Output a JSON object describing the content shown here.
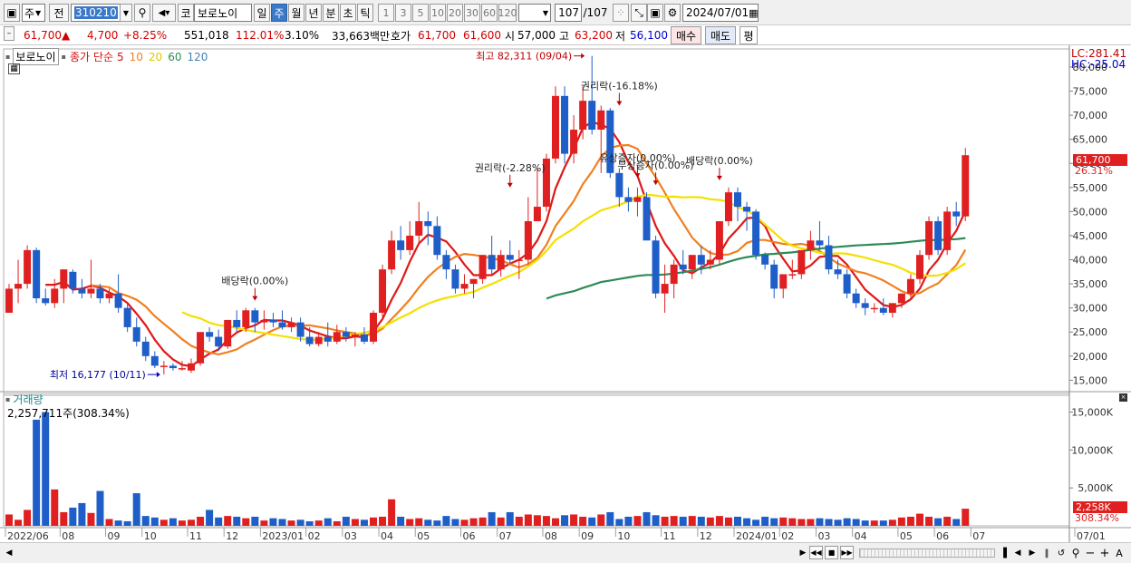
{
  "toolbar": {
    "market_type": "주",
    "prev_label": "전",
    "code": "310210",
    "stock_type": "코",
    "stock_name": "보로노이",
    "period_day": "일",
    "period_week": "주",
    "period_month": "월",
    "period_year": "년",
    "period_min": "분",
    "period_sec": "초",
    "period_tick": "틱",
    "intervals": [
      "1",
      "3",
      "5",
      "10",
      "20",
      "30",
      "60",
      "120"
    ],
    "count": "107",
    "count_total": "/107",
    "date": "2024/07/01"
  },
  "quote": {
    "price": "61,700",
    "change_arrow": "▲",
    "change": "4,700",
    "change_pct": "+8.25%",
    "volume": "551,018",
    "volume_ratio": "112.01%",
    "turnover": "3.10%",
    "amount": "33,663백만",
    "ask_label": "호가",
    "ask": "61,700",
    "bid": "61,600",
    "open_label": "시",
    "open": "57,000",
    "high_label": "고",
    "high": "63,200",
    "low_label": "저",
    "low": "56,100",
    "buy_label": "매수",
    "sell_label": "매도",
    "eval_label": "평"
  },
  "legend": {
    "stock_name": "보로노이",
    "ma_title": "종가 단순",
    "ma5": "5",
    "ma10": "10",
    "ma20": "20",
    "ma60": "60",
    "ma120": "120",
    "volume_title": "거래량",
    "volume_value": "2,257,711주(308.34%)"
  },
  "right_panel": {
    "lc": "LC:281.41",
    "hc": "HC:-25.04",
    "last_price": "61,700",
    "last_pct": "26.31%",
    "last_vol": "2,258K",
    "last_vol_pct": "308.34%"
  },
  "chart_data": {
    "type": "candlestick",
    "price_axis": {
      "min": 13000,
      "max": 83000,
      "ticks": [
        15000,
        20000,
        25000,
        30000,
        35000,
        40000,
        45000,
        50000,
        55000,
        60000,
        65000,
        70000,
        75000,
        80000
      ],
      "tick_labels": [
        "15,000",
        "20,000",
        "25,000",
        "30,000",
        "35,000",
        "40,000",
        "45,000",
        "50,000",
        "55,000",
        "60,000",
        "65,000",
        "70,000",
        "75,000",
        "80,000"
      ]
    },
    "volume_axis": {
      "min": 0,
      "max": 16500000,
      "ticks": [
        5000000,
        10000000,
        15000000
      ],
      "tick_labels": [
        "5,000K",
        "10,000K",
        "15,000K"
      ]
    },
    "x_labels": [
      {
        "i": 0,
        "label": "2022/06"
      },
      {
        "i": 6,
        "label": "08"
      },
      {
        "i": 11,
        "label": "09"
      },
      {
        "i": 15,
        "label": "10"
      },
      {
        "i": 20,
        "label": "11"
      },
      {
        "i": 24,
        "label": "12"
      },
      {
        "i": 28,
        "label": "2023/01"
      },
      {
        "i": 33,
        "label": "02"
      },
      {
        "i": 37,
        "label": "03"
      },
      {
        "i": 41,
        "label": "04"
      },
      {
        "i": 45,
        "label": "05"
      },
      {
        "i": 50,
        "label": "06"
      },
      {
        "i": 54,
        "label": "07"
      },
      {
        "i": 59,
        "label": "08"
      },
      {
        "i": 63,
        "label": "09"
      },
      {
        "i": 67,
        "label": "10"
      },
      {
        "i": 72,
        "label": "11"
      },
      {
        "i": 76,
        "label": "12"
      },
      {
        "i": 80,
        "label": "2024/01"
      },
      {
        "i": 85,
        "label": "02"
      },
      {
        "i": 89,
        "label": "03"
      },
      {
        "i": 93,
        "label": "04"
      },
      {
        "i": 98,
        "label": "05"
      },
      {
        "i": 102,
        "label": "06"
      },
      {
        "i": 106,
        "label": "07"
      },
      {
        "i": 111,
        "label": "07/01"
      }
    ],
    "ohlc": [
      [
        29000,
        35000,
        29000,
        34000
      ],
      [
        34000,
        40000,
        31000,
        35000
      ],
      [
        35000,
        43000,
        34000,
        42000
      ],
      [
        42000,
        42500,
        31000,
        32000
      ],
      [
        32000,
        34000,
        30500,
        31000
      ],
      [
        31000,
        36000,
        30000,
        34000
      ],
      [
        34000,
        38000,
        31000,
        38000
      ],
      [
        37500,
        38000,
        33000,
        34000
      ],
      [
        34000,
        36000,
        32000,
        33000
      ],
      [
        33000,
        40000,
        32000,
        34000
      ],
      [
        34000,
        35000,
        31000,
        32000
      ],
      [
        32000,
        34000,
        31000,
        33000
      ],
      [
        33000,
        37000,
        29000,
        30000
      ],
      [
        30000,
        31000,
        25000,
        26000
      ],
      [
        26000,
        28000,
        22000,
        23000
      ],
      [
        23000,
        24000,
        19000,
        20000
      ],
      [
        20000,
        21000,
        17500,
        18000
      ],
      [
        18000,
        19000,
        16177,
        18000
      ],
      [
        18000,
        18500,
        17000,
        17500
      ],
      [
        17500,
        19000,
        17000,
        17500
      ],
      [
        17000,
        19500,
        16500,
        18500
      ],
      [
        18500,
        25000,
        18000,
        25000
      ],
      [
        25000,
        26000,
        23000,
        24000
      ],
      [
        24000,
        25500,
        21000,
        22000
      ],
      [
        22000,
        27500,
        21500,
        27500
      ],
      [
        27500,
        29500,
        25000,
        26000
      ],
      [
        26000,
        30000,
        25000,
        29500
      ],
      [
        29500,
        30000,
        25000,
        27000
      ],
      [
        27000,
        29500,
        25500,
        27500
      ],
      [
        27500,
        29000,
        26000,
        27000
      ],
      [
        27000,
        29500,
        25500,
        26000
      ],
      [
        26000,
        28000,
        25000,
        27000
      ],
      [
        27000,
        28000,
        23000,
        24000
      ],
      [
        24000,
        26000,
        22000,
        22500
      ],
      [
        22500,
        25000,
        22000,
        24000
      ],
      [
        24000,
        27000,
        22000,
        23000
      ],
      [
        23000,
        26500,
        22500,
        25000
      ],
      [
        25000,
        26000,
        23000,
        24000
      ],
      [
        24000,
        25000,
        22000,
        24500
      ],
      [
        24500,
        26000,
        22500,
        23000
      ],
      [
        23000,
        29500,
        22500,
        29000
      ],
      [
        29000,
        39000,
        28000,
        38000
      ],
      [
        38000,
        46000,
        37000,
        44000
      ],
      [
        44000,
        47000,
        40000,
        42000
      ],
      [
        42000,
        48000,
        41000,
        45000
      ],
      [
        45000,
        52000,
        43000,
        48000
      ],
      [
        48000,
        50000,
        43000,
        47000
      ],
      [
        47000,
        49000,
        40000,
        41000
      ],
      [
        41000,
        42000,
        36000,
        38000
      ],
      [
        38000,
        39000,
        33000,
        34000
      ],
      [
        34000,
        37000,
        33000,
        35000
      ],
      [
        35000,
        36000,
        32000,
        36000
      ],
      [
        36000,
        41000,
        35000,
        41000
      ],
      [
        41000,
        45000,
        37000,
        38000
      ],
      [
        38000,
        42000,
        36500,
        41000
      ],
      [
        41000,
        44000,
        39000,
        40000
      ],
      [
        40000,
        42000,
        36000,
        40000
      ],
      [
        40000,
        53000,
        39000,
        48000
      ],
      [
        48000,
        59000,
        48000,
        51000
      ],
      [
        51000,
        62000,
        50000,
        61000
      ],
      [
        61000,
        76000,
        60000,
        74000
      ],
      [
        74000,
        76000,
        60000,
        62000
      ],
      [
        62000,
        70000,
        60000,
        67000
      ],
      [
        67000,
        76000,
        65000,
        73000
      ],
      [
        73000,
        82311,
        66000,
        67000
      ],
      [
        67000,
        72000,
        58000,
        71000
      ],
      [
        71000,
        71500,
        57000,
        58000
      ],
      [
        58000,
        59000,
        51000,
        53000
      ],
      [
        53000,
        55000,
        50000,
        52000
      ],
      [
        52000,
        55000,
        49000,
        53000
      ],
      [
        53000,
        54000,
        45000,
        44000
      ],
      [
        44000,
        45000,
        32000,
        33000
      ],
      [
        33000,
        39000,
        29000,
        35000
      ],
      [
        35000,
        40000,
        32000,
        39000
      ],
      [
        39000,
        42000,
        37000,
        38000
      ],
      [
        38000,
        41000,
        36000,
        41000
      ],
      [
        41000,
        43000,
        37000,
        39000
      ],
      [
        39000,
        42000,
        38000,
        40000
      ],
      [
        40000,
        48000,
        39000,
        48000
      ],
      [
        48000,
        55000,
        47000,
        54000
      ],
      [
        54000,
        55000,
        48000,
        51000
      ],
      [
        51000,
        52000,
        46000,
        50000
      ],
      [
        50000,
        50500,
        40000,
        41000
      ],
      [
        41000,
        41500,
        38000,
        39000
      ],
      [
        39000,
        40000,
        32000,
        34000
      ],
      [
        34000,
        37000,
        32000,
        37000
      ],
      [
        37000,
        40000,
        36000,
        37000
      ],
      [
        37000,
        42000,
        36000,
        42000
      ],
      [
        42000,
        46000,
        40000,
        44000
      ],
      [
        44000,
        48000,
        42000,
        43000
      ],
      [
        43000,
        45000,
        37000,
        38000
      ],
      [
        38000,
        40000,
        36000,
        37000
      ],
      [
        37000,
        38000,
        32000,
        33000
      ],
      [
        33000,
        34000,
        30000,
        31000
      ],
      [
        31000,
        32000,
        28500,
        30000
      ],
      [
        30000,
        31000,
        29000,
        30000
      ],
      [
        30000,
        32000,
        28500,
        29000
      ],
      [
        29000,
        31000,
        28000,
        31000
      ],
      [
        31000,
        33000,
        30000,
        33000
      ],
      [
        33000,
        37000,
        32000,
        36000
      ],
      [
        36000,
        42000,
        35000,
        41000
      ],
      [
        41000,
        49000,
        40000,
        48000
      ],
      [
        48000,
        49000,
        41000,
        42000
      ],
      [
        42000,
        51000,
        41000,
        50000
      ],
      [
        50000,
        52000,
        47000,
        49000
      ],
      [
        49000,
        63200,
        48000,
        61700
      ]
    ],
    "volume": [
      1500000,
      800000,
      2100000,
      14000000,
      15000000,
      4800000,
      1800000,
      2400000,
      3000000,
      1700000,
      4600000,
      900000,
      700000,
      600000,
      4300000,
      1300000,
      1100000,
      800000,
      1000000,
      700000,
      800000,
      1200000,
      2100000,
      1100000,
      1300000,
      1200000,
      1000000,
      1200000,
      700000,
      1000000,
      900000,
      700000,
      800000,
      600000,
      700000,
      1000000,
      600000,
      1200000,
      900000,
      800000,
      1100000,
      1200000,
      3500000,
      1200000,
      900000,
      1000000,
      800000,
      700000,
      1300000,
      900000,
      800000,
      1000000,
      1100000,
      1800000,
      1100000,
      1800000,
      1200000,
      1500000,
      1400000,
      1300000,
      1000000,
      1400000,
      1500000,
      1200000,
      1100000,
      1500000,
      1800000,
      900000,
      1200000,
      1300000,
      1800000,
      1400000,
      1200000,
      1300000,
      1200000,
      1300000,
      1200000,
      1100000,
      1300000,
      1100000,
      1200000,
      1000000,
      800000,
      1200000,
      1000000,
      1100000,
      1000000,
      900000,
      900000,
      1000000,
      900000,
      800000,
      1000000,
      900000,
      700000,
      700000,
      700000,
      800000,
      1100000,
      1200000,
      1600000,
      1200000,
      1000000,
      1200000,
      900000,
      2258000
    ],
    "annotations": [
      {
        "text": "최고 82,311 (09/04)",
        "i": 63,
        "price": 82311
      },
      {
        "text": "최저 16,177 (10/11)",
        "i": 17,
        "price": 16177
      },
      {
        "text": "권리락(-16.18%)",
        "i": 67,
        "price": 72000
      },
      {
        "text": "권리락(-2.28%)",
        "i": 55,
        "price": 55000
      },
      {
        "text": "배당락(0.00%)",
        "i": 27,
        "price": 31500
      },
      {
        "text": "배당락(0.00%)",
        "i": 78,
        "price": 56500
      },
      {
        "text": "유상증자(0.00%)",
        "i": 69,
        "price": 57000
      },
      {
        "text": "무상증자(0.00%)",
        "i": 71,
        "price": 55500
      }
    ],
    "series_colors": {
      "up": "#e02020",
      "down": "#1e5ec8",
      "ma5": "#e01818",
      "ma10": "#f08020",
      "ma20": "#f4e000",
      "ma60": "#2e8b57",
      "ma120": "#4682b4"
    }
  }
}
